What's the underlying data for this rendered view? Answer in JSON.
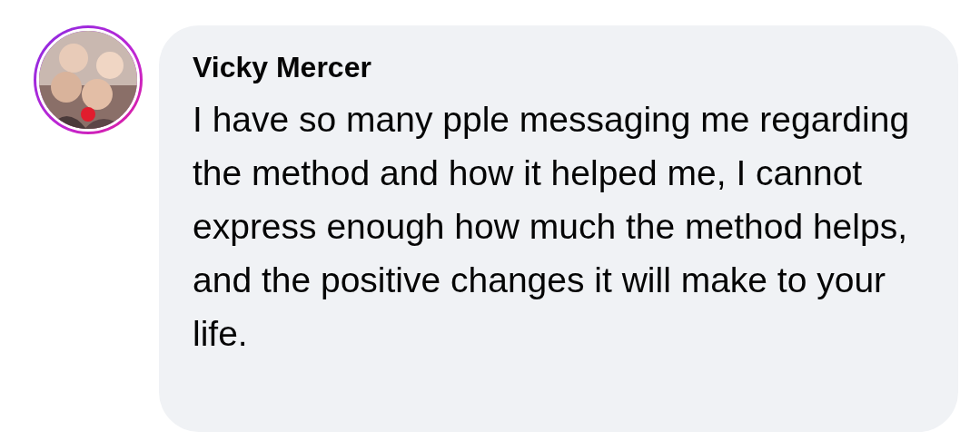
{
  "comment": {
    "author": "Vicky Mercer",
    "text": "I have so many pple messaging me regarding the method and how it helped me, I cannot express enough how much the method helps, and the positive changes it will make to your life."
  }
}
